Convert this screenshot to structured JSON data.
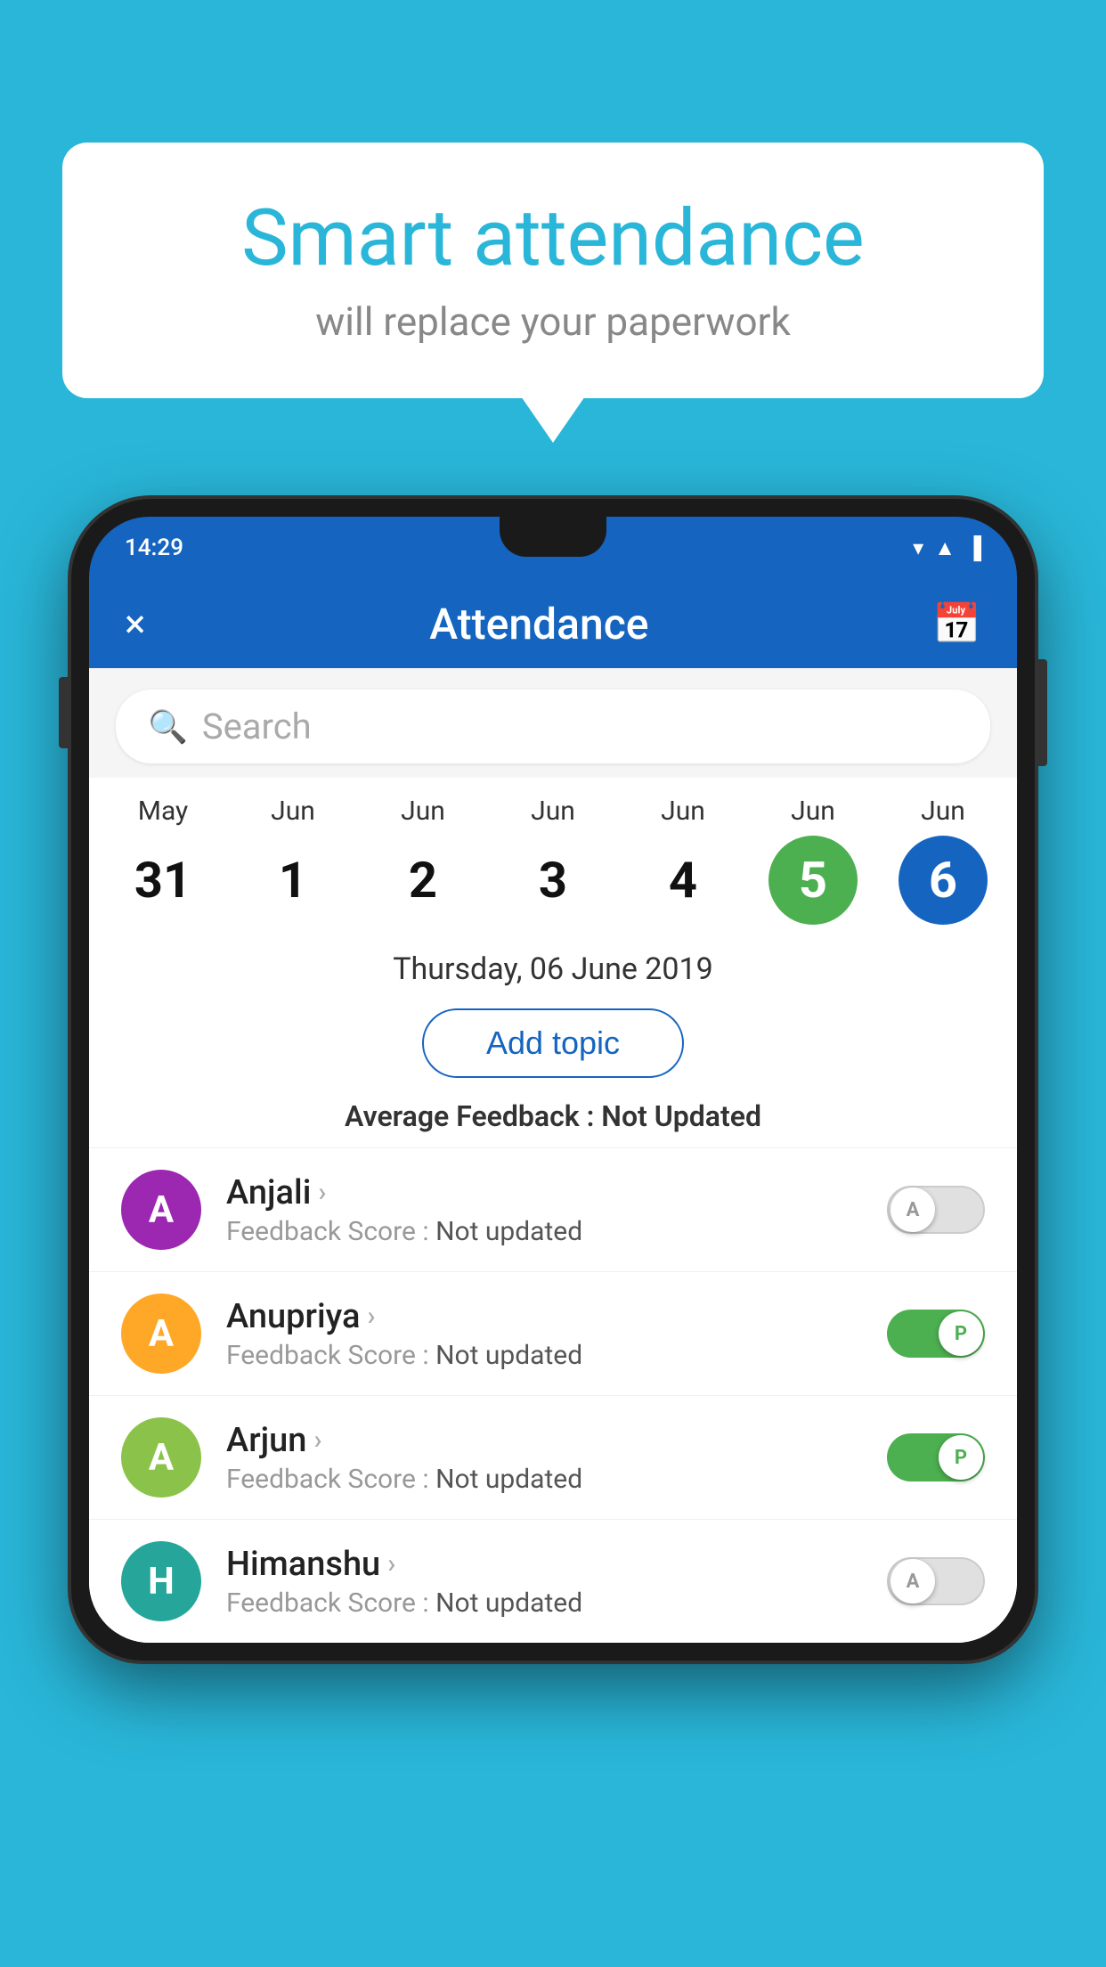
{
  "background_color": "#29b6d8",
  "bubble": {
    "title": "Smart attendance",
    "subtitle": "will replace your paperwork"
  },
  "phone": {
    "status": {
      "time": "14:29"
    },
    "header": {
      "title": "Attendance",
      "close_label": "×",
      "calendar_icon": "calendar"
    },
    "search": {
      "placeholder": "Search"
    },
    "calendar": {
      "days": [
        {
          "month": "May",
          "date": "31",
          "style": "normal"
        },
        {
          "month": "Jun",
          "date": "1",
          "style": "normal"
        },
        {
          "month": "Jun",
          "date": "2",
          "style": "normal"
        },
        {
          "month": "Jun",
          "date": "3",
          "style": "normal"
        },
        {
          "month": "Jun",
          "date": "4",
          "style": "normal"
        },
        {
          "month": "Jun",
          "date": "5",
          "style": "green"
        },
        {
          "month": "Jun",
          "date": "6",
          "style": "blue"
        }
      ]
    },
    "selected_date": "Thursday, 06 June 2019",
    "add_topic_label": "Add topic",
    "avg_feedback_label": "Average Feedback :",
    "avg_feedback_value": "Not Updated",
    "students": [
      {
        "name": "Anjali",
        "avatar_letter": "A",
        "avatar_color": "purple",
        "feedback": "Not updated",
        "toggle": "off",
        "toggle_letter": "A"
      },
      {
        "name": "Anupriya",
        "avatar_letter": "A",
        "avatar_color": "orange",
        "feedback": "Not updated",
        "toggle": "on",
        "toggle_letter": "P"
      },
      {
        "name": "Arjun",
        "avatar_letter": "A",
        "avatar_color": "green-light",
        "feedback": "Not updated",
        "toggle": "on",
        "toggle_letter": "P"
      },
      {
        "name": "Himanshu",
        "avatar_letter": "H",
        "avatar_color": "teal",
        "feedback": "Not updated",
        "toggle": "off",
        "toggle_letter": "A"
      }
    ]
  }
}
